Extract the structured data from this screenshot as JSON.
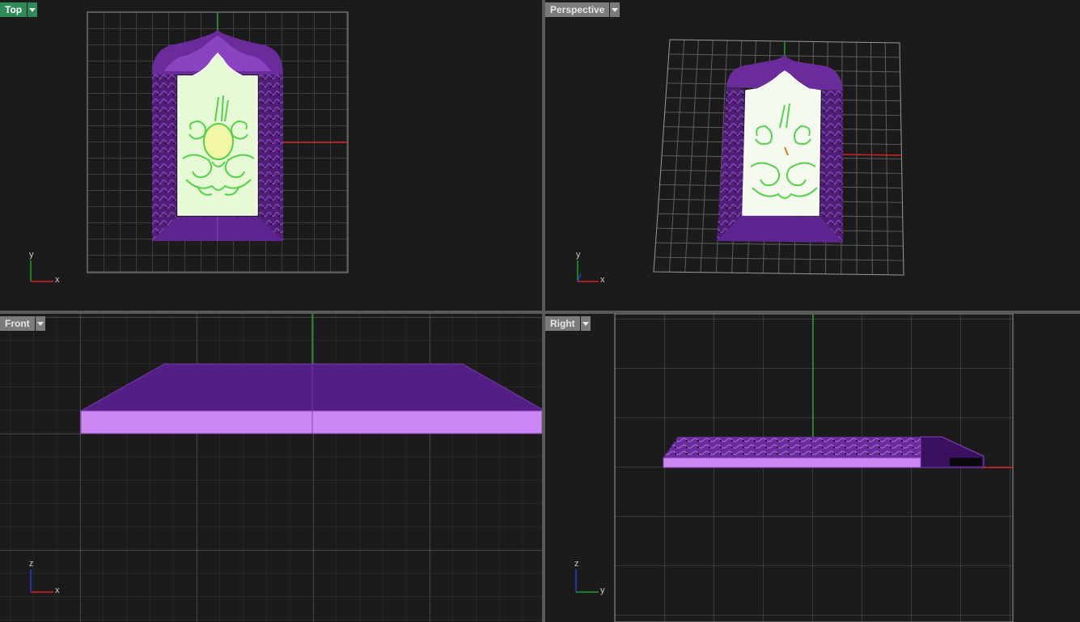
{
  "viewports": {
    "top": {
      "label": "Top",
      "active": true
    },
    "perspective": {
      "label": "Perspective",
      "active": false
    },
    "front": {
      "label": "Front",
      "active": false
    },
    "right": {
      "label": "Right",
      "active": false
    }
  },
  "axes": {
    "top": {
      "h": "x",
      "v": "y"
    },
    "perspective": {
      "h": "x",
      "v": "y"
    },
    "front": {
      "h": "x",
      "v": "z"
    },
    "right": {
      "h": "y",
      "v": "z"
    }
  },
  "colors": {
    "viewport_bg": "#1b1b1b",
    "grid_line": "#5e5e5e",
    "grid_border": "#9a9a9a",
    "x_axis": "#d42020",
    "y_axis": "#1e9e2a",
    "z_axis": "#2b3cd6",
    "frame_purple": "#6a2c9a",
    "frame_purple_dark": "#4f1f78",
    "frame_purple_light": "#cc88f2",
    "panel_fill": "#e6fad6",
    "ornament_line": "#55d24a",
    "active_tab": "#2e8b57"
  }
}
